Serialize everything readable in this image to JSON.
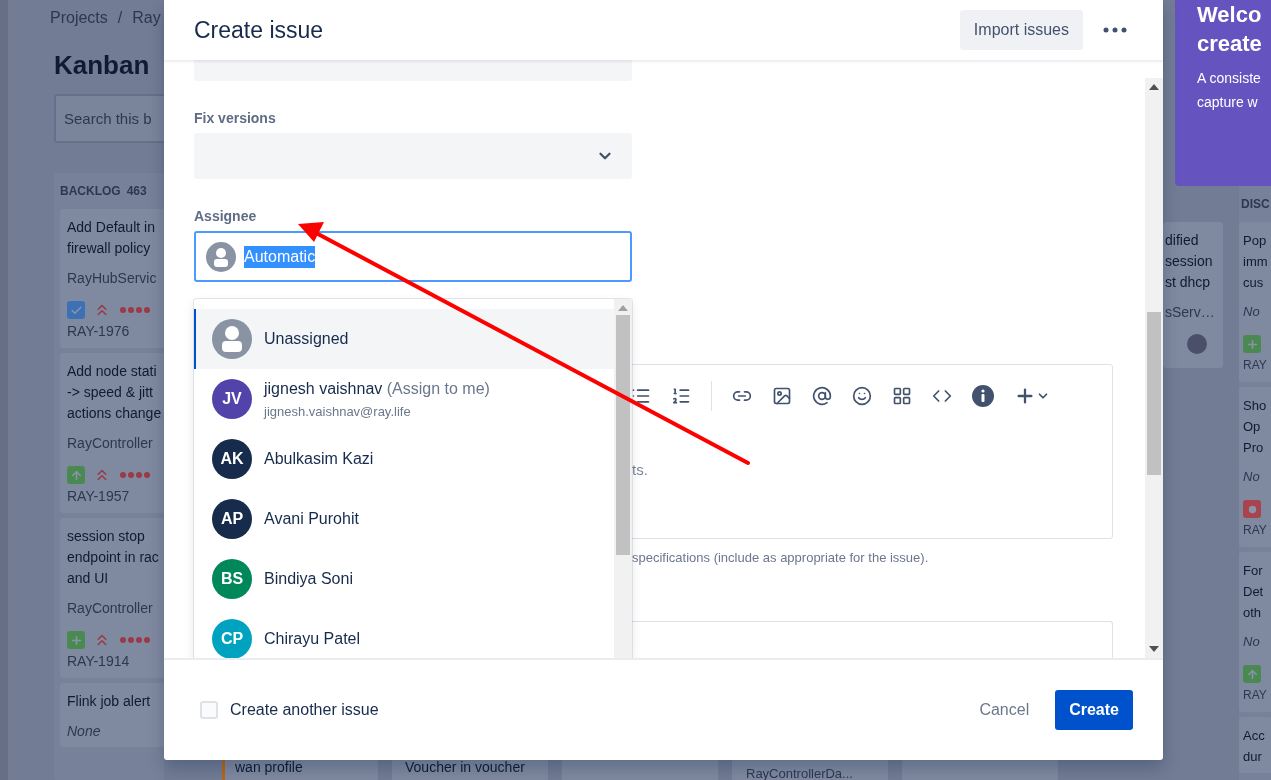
{
  "board": {
    "breadcrumb": [
      "Projects",
      "/",
      "Ray"
    ],
    "title": "Kanban",
    "search": {
      "placeholder": "Search this b"
    },
    "backlog": {
      "name": "BACKLOG",
      "count": "463",
      "cards": [
        {
          "lines": [
            "Add Default in",
            "firewall policy"
          ],
          "component": "RayHubServic",
          "component_set": true,
          "kind": "task",
          "key": "RAY-1976"
        },
        {
          "lines": [
            "Add node stati",
            "-> speed & jitt",
            "actions change"
          ],
          "component": "RayController",
          "component_set": true,
          "kind": "story",
          "key": "RAY-1957"
        },
        {
          "lines": [
            "session stop",
            "endpoint in rac",
            "and UI"
          ],
          "component": "RayController",
          "component_set": true,
          "kind": "new_feature",
          "key": "RAY-1914"
        },
        {
          "lines": [
            "Flink job alert"
          ],
          "component": "None",
          "component_set": false
        }
      ]
    },
    "bottom_cards": [
      {
        "kind": "title",
        "text": "wan profile",
        "color": "#b8661a"
      },
      {
        "kind": "title",
        "text": "Voucher in voucher"
      },
      {
        "kind": "empty"
      },
      {
        "kind": "component",
        "text": "RayControllerDa..."
      },
      {
        "kind": "empty"
      }
    ],
    "partial_column": {
      "cards": [
        {
          "lines": [
            "dified",
            "session",
            "st dhcp"
          ],
          "component": "sServ…"
        }
      ]
    },
    "discovery_column": {
      "name": "DISC",
      "cards": [
        {
          "lines": [
            "Pop",
            "imm",
            "cus"
          ],
          "component": "No",
          "component_set": false,
          "kind": "new_feature",
          "key": "RAY"
        },
        {
          "lines": [
            "Sho",
            "Op",
            "Pro"
          ],
          "component": "No",
          "component_set": false,
          "kind": "bug",
          "key": "RAY"
        },
        {
          "lines": [
            "For",
            "Det",
            "oth"
          ],
          "component": "No",
          "component_set": false,
          "kind": "story",
          "key": "RAY"
        },
        {
          "lines": [
            "Acc",
            "dur"
          ]
        }
      ]
    }
  },
  "welcome": {
    "title_lines": [
      "Welco",
      "create"
    ],
    "text_lines": [
      "A consiste",
      "capture w"
    ]
  },
  "modal": {
    "title": "Create issue",
    "import_button": "Import issues",
    "fix_versions": {
      "label": "Fix versions"
    },
    "assignee": {
      "label": "Assignee",
      "value": "Automatic",
      "value_highlighted": true
    },
    "assignee_options": [
      {
        "kind": "unassigned",
        "name": "Unassigned",
        "selected": true
      },
      {
        "kind": "user",
        "initials": "JV",
        "name": "jignesh vaishnav",
        "note": "(Assign to me)",
        "email": "jignesh.vaishnav@ray.life",
        "color": "#5243aa",
        "selected": false
      },
      {
        "kind": "user",
        "initials": "AK",
        "name": "Abulkasim Kazi",
        "color": "#172b4d",
        "selected": false
      },
      {
        "kind": "user",
        "initials": "AP",
        "name": "Avani Purohit",
        "color": "#172b4d",
        "selected": false
      },
      {
        "kind": "user",
        "initials": "BS",
        "name": "Bindiya Soni",
        "color": "#00875a",
        "selected": false
      },
      {
        "kind": "user",
        "initials": "CP",
        "name": "Chirayu Patel",
        "color": "#00a3bf",
        "selected": false
      }
    ],
    "description": {
      "placeholder": "ts.",
      "help": "specifications (include as appropriate for the issue)."
    },
    "create_another": {
      "label": "Create another issue",
      "checked": false
    },
    "cancel": "Cancel",
    "create": "Create"
  }
}
